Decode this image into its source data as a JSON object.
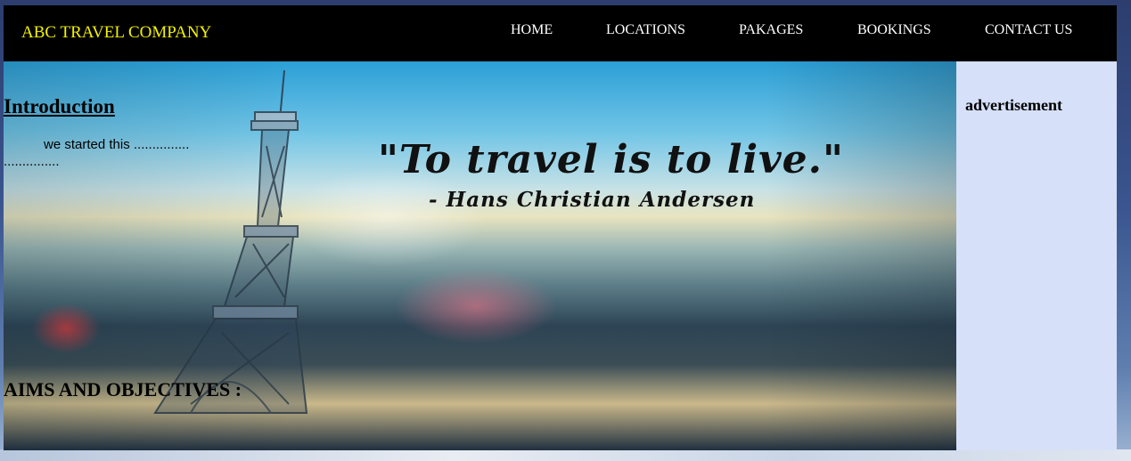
{
  "header": {
    "brand": "ABC TRAVEL COMPANY",
    "nav": [
      "HOME",
      "LOCATIONS",
      "PAKAGES",
      "BOOKINGS",
      "CONTACT US"
    ]
  },
  "main": {
    "quote": "\"To travel is to live.\"",
    "quote_author": "- Hans Christian Andersen",
    "intro_heading": "Introduction",
    "intro_text": "we started this ............... ...............",
    "aims_heading": "AIMS AND OBJECTIVES :"
  },
  "sidebar": {
    "heading": "advertisement"
  },
  "colors": {
    "header_bg": "#000000",
    "brand_text": "#f2f200",
    "nav_text": "#ffffff",
    "sidebar_bg": "#d6e0f8"
  },
  "icons": [
    "eiffel-tower-illustration"
  ]
}
